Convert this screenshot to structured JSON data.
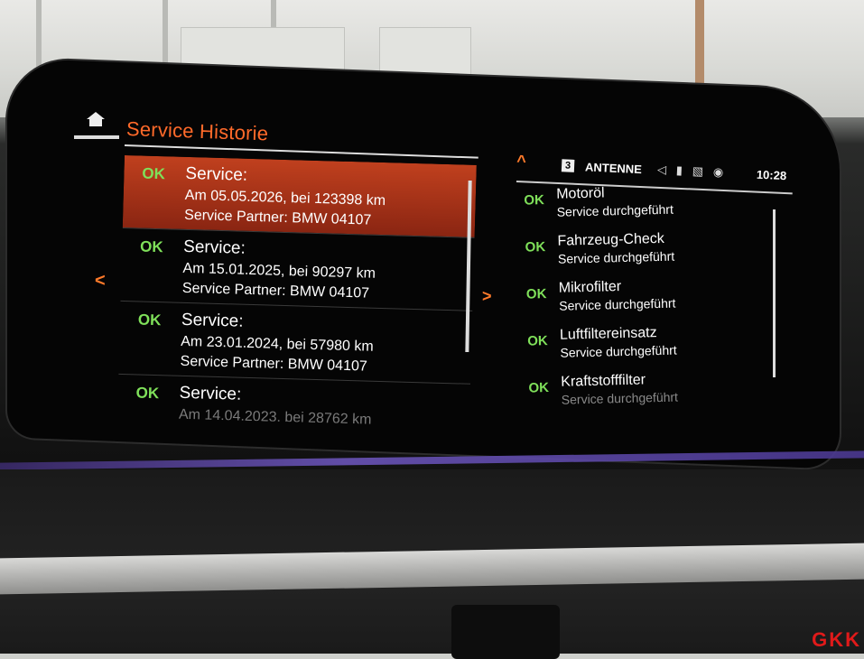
{
  "header": {
    "title": "Service Historie"
  },
  "service_entries": [
    {
      "status": "OK",
      "heading": "Service:",
      "line1": "Am 05.05.2026, bei 123398 km",
      "line2": "Service Partner: BMW 04107",
      "active": true
    },
    {
      "status": "OK",
      "heading": "Service:",
      "line1": "Am 15.01.2025, bei 90297 km",
      "line2": "Service Partner: BMW 04107"
    },
    {
      "status": "OK",
      "heading": "Service:",
      "line1": "Am 23.01.2024, bei 57980 km",
      "line2": "Service Partner: BMW 04107"
    },
    {
      "status": "OK",
      "heading": "Service:",
      "line1": "Am 14.04.2023, bei 28762 km",
      "line2": ""
    }
  ],
  "status_bar": {
    "preset": "3",
    "station": "ANTENNE",
    "clock": "10:28"
  },
  "checks": [
    {
      "status": "OK",
      "name": "Motoröl",
      "sub": "Service durchgeführt"
    },
    {
      "status": "OK",
      "name": "Fahrzeug-Check",
      "sub": "Service durchgeführt"
    },
    {
      "status": "OK",
      "name": "Mikrofilter",
      "sub": "Service durchgeführt"
    },
    {
      "status": "OK",
      "name": "Luftfiltereinsatz",
      "sub": "Service durchgeführt"
    },
    {
      "status": "OK",
      "name": "Kraftstofffilter",
      "sub": "Service durchgeführt"
    }
  ],
  "icons": {
    "home": "home-icon",
    "back": "chevron-left-icon",
    "forward": "chevron-right-icon",
    "up": "chevron-up-icon"
  },
  "colors": {
    "accent": "#ff6a2a",
    "ok": "#7fe05a",
    "active_row": "#b73a1c"
  },
  "watermark": {
    "brand": "GKK"
  }
}
